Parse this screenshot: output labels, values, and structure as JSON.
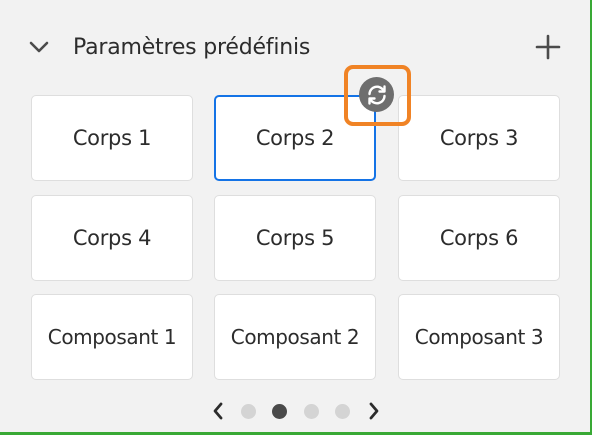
{
  "panel": {
    "title": "Paramètres prédéfinis"
  },
  "icons": {
    "collapse": "chevron-down-icon",
    "add": "plus-icon",
    "sync": "refresh-icon",
    "prev": "chevron-left-icon",
    "next": "chevron-right-icon"
  },
  "presets": [
    {
      "label": "Corps 1",
      "selected": false
    },
    {
      "label": "Corps 2",
      "selected": true
    },
    {
      "label": "Corps 3",
      "selected": false
    },
    {
      "label": "Corps 4",
      "selected": false
    },
    {
      "label": "Corps 5",
      "selected": false
    },
    {
      "label": "Corps 6",
      "selected": false
    },
    {
      "label": "Composant 1",
      "selected": false
    },
    {
      "label": "Composant 2",
      "selected": false
    },
    {
      "label": "Composant 3",
      "selected": false
    }
  ],
  "pagination": {
    "pages": 4,
    "current": 2
  },
  "colors": {
    "selected_border": "#1473e6",
    "highlight": "#f08325",
    "sync_button": "#6e6e6e",
    "frame": "#39a935"
  }
}
